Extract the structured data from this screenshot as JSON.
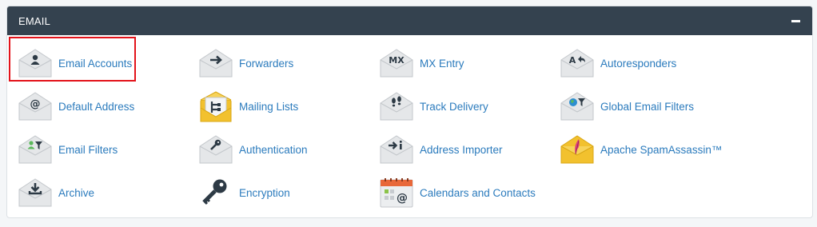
{
  "section": {
    "title": "EMAIL",
    "collapse_icon": "minus-icon"
  },
  "accent_color": "#2b7bbd",
  "header_color": "#34424f",
  "highlight_color": "#e3131a",
  "items": [
    {
      "label": "Email Accounts",
      "icon": "user-envelope-icon"
    },
    {
      "label": "Forwarders",
      "icon": "arrow-right-envelope-icon"
    },
    {
      "label": "MX Entry",
      "icon": "mx-envelope-icon"
    },
    {
      "label": "Autoresponders",
      "icon": "reply-envelope-icon"
    },
    {
      "label": "Default Address",
      "icon": "at-envelope-icon"
    },
    {
      "label": "Mailing Lists",
      "icon": "mailing-list-envelope-icon"
    },
    {
      "label": "Track Delivery",
      "icon": "footprints-envelope-icon"
    },
    {
      "label": "Global Email Filters",
      "icon": "globe-filter-envelope-icon"
    },
    {
      "label": "Email Filters",
      "icon": "filter-envelope-icon"
    },
    {
      "label": "Authentication",
      "icon": "key-envelope-icon"
    },
    {
      "label": "Address Importer",
      "icon": "import-envelope-icon"
    },
    {
      "label": "Apache SpamAssassin™",
      "icon": "feather-envelope-icon"
    },
    {
      "label": "Archive",
      "icon": "download-envelope-icon"
    },
    {
      "label": "Encryption",
      "icon": "key-icon"
    },
    {
      "label": "Calendars and Contacts",
      "icon": "calendar-icon"
    }
  ]
}
